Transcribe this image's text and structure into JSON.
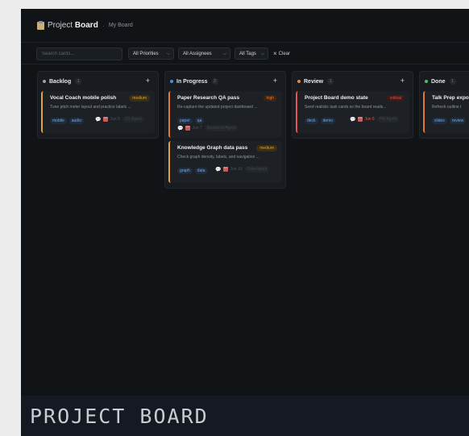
{
  "header": {
    "app_title_prefix": "Project",
    "app_title_bold": "Board",
    "breadcrumb": "My Board"
  },
  "filters": {
    "search_placeholder": "Search cards...",
    "priority": "All Priorities",
    "assignee": "All Assignees",
    "tags": "All Tags",
    "clear_label": "Clear"
  },
  "columns": [
    {
      "title": "Backlog",
      "count": "1",
      "dot_color": "#9aa0a6",
      "cards": [
        {
          "title": "Vocal Coach mobile polish",
          "priority": "medium",
          "desc": "Tune pitch meter layout and practice labels ...",
          "tags": [
            "mobile",
            "audio"
          ],
          "due": "Jun 9",
          "agent": "UX Agent",
          "overdue": false
        }
      ]
    },
    {
      "title": "In Progress",
      "count": "2",
      "dot_color": "#4e8fe6",
      "cards": [
        {
          "title": "Paper Research QA pass",
          "priority": "high",
          "desc": "Re-capture the updated project dashboard ...",
          "tags": [
            "paper",
            "qa"
          ],
          "due": "Jun 7",
          "agent": "Research Agent",
          "overdue": false
        },
        {
          "title": "Knowledge Graph data pass",
          "priority": "medium",
          "desc": "Check graph density, labels, and navigation ...",
          "tags": [
            "graph",
            "data"
          ],
          "due": "Jun 10",
          "agent": "Data Agent",
          "overdue": false
        }
      ]
    },
    {
      "title": "Review",
      "count": "1",
      "dot_color": "#e8883a",
      "cards": [
        {
          "title": "Project Board demo state",
          "priority": "critical",
          "desc": "Seed realistic task cards so the board reads...",
          "tags": [
            "deck",
            "demo"
          ],
          "due": "Jun 6",
          "agent": "PM Agent",
          "overdue": true
        }
      ]
    },
    {
      "title": "Done",
      "count": "1",
      "dot_color": "#5bb86a",
      "cards": [
        {
          "title": "Talk Prep expo",
          "priority": "",
          "desc": "Refresh outline t",
          "tags": [
            "slides",
            "review"
          ],
          "due": "",
          "agent": "",
          "overdue": false
        }
      ]
    }
  ],
  "priority_colors": {
    "medium": {
      "fg": "#d9a441",
      "bg": "#3a2e17"
    },
    "high": {
      "fg": "#e07a3a",
      "bg": "#3b2415"
    },
    "critical": {
      "fg": "#e25555",
      "bg": "#3b1c1c"
    }
  },
  "banner": {
    "text": "PROJECT BOARD"
  }
}
